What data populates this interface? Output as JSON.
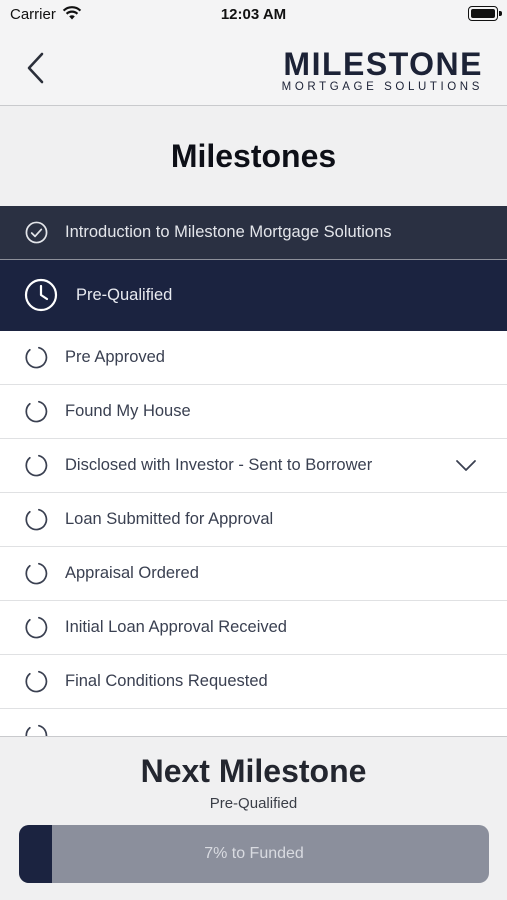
{
  "status_bar": {
    "carrier": "Carrier",
    "time": "12:03 AM"
  },
  "nav": {
    "logo_word": "MILESTONE",
    "logo_sub": "MORTGAGE SOLUTIONS"
  },
  "page_title": "Milestones",
  "milestones": [
    {
      "label": "Introduction to Milestone Mortgage Solutions",
      "state": "complete"
    },
    {
      "label": "Pre-Qualified",
      "state": "current"
    },
    {
      "label": "Pre Approved",
      "state": "pending"
    },
    {
      "label": "Found My House",
      "state": "pending"
    },
    {
      "label": "Disclosed with Investor - Sent to Borrower",
      "state": "pending",
      "expandable": true
    },
    {
      "label": "Loan Submitted for Approval",
      "state": "pending"
    },
    {
      "label": "Appraisal Ordered",
      "state": "pending"
    },
    {
      "label": "Initial Loan Approval Received",
      "state": "pending"
    },
    {
      "label": "Final Conditions Requested",
      "state": "pending"
    },
    {
      "label": "",
      "state": "pending"
    }
  ],
  "footer": {
    "heading": "Next Milestone",
    "next_name": "Pre-Qualified",
    "progress_text": "7% to Funded",
    "progress_fraction": 0.07
  },
  "colors": {
    "navy": "#1b2340",
    "completed_row": "#2a3042",
    "progress_track": "#8b8f9c"
  }
}
